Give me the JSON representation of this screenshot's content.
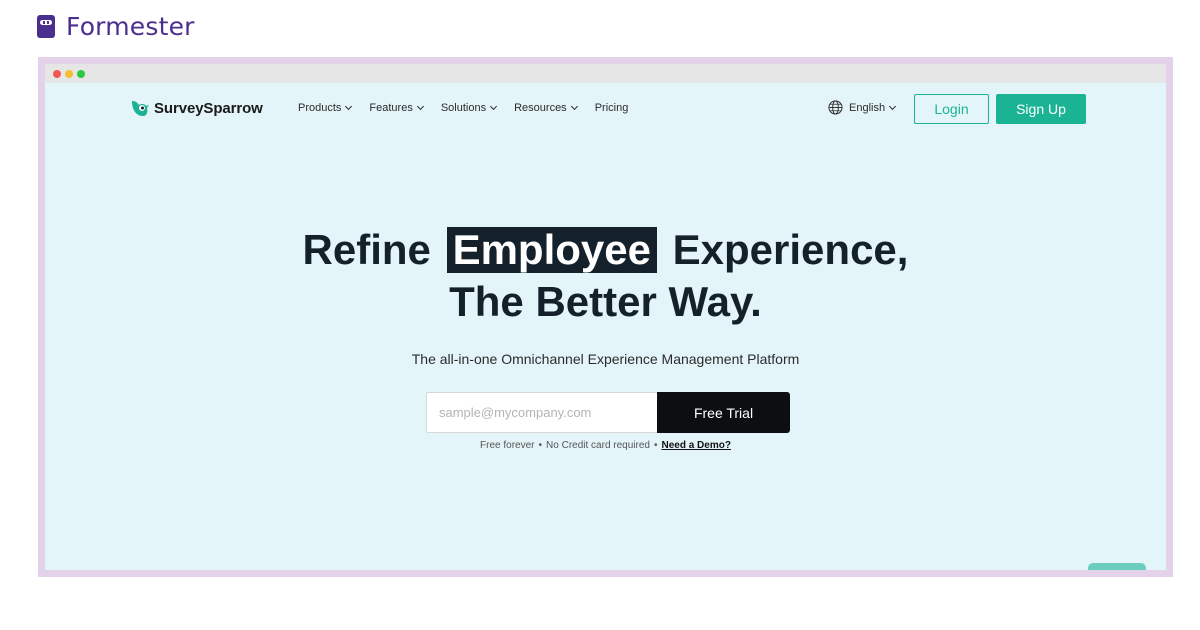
{
  "brand": {
    "name": "Formester",
    "color": "#4b2f8f"
  },
  "site": {
    "logo_text": "SurveySparrow",
    "accent": "#1ab394",
    "nav": [
      {
        "label": "Products",
        "has_dropdown": true
      },
      {
        "label": "Features",
        "has_dropdown": true
      },
      {
        "label": "Solutions",
        "has_dropdown": true
      },
      {
        "label": "Resources",
        "has_dropdown": true
      },
      {
        "label": "Pricing",
        "has_dropdown": false
      }
    ],
    "language": "English",
    "login_label": "Login",
    "signup_label": "Sign Up"
  },
  "hero": {
    "line1_before": "Refine",
    "line1_highlight": "Employee",
    "line1_after": "Experience,",
    "line2": "The Better Way.",
    "subtitle": "The all-in-one Omnichannel Experience Management Platform",
    "email_placeholder": "sample@mycompany.com",
    "cta_label": "Free Trial",
    "note_part1": "Free forever",
    "note_part2": "No Credit card required",
    "demo_link": "Need a Demo?"
  }
}
